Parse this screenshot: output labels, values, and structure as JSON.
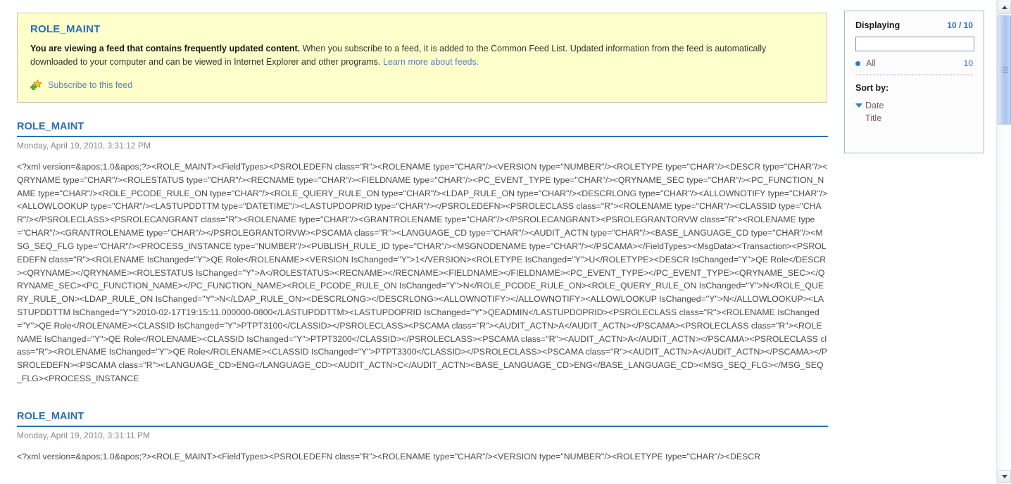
{
  "banner": {
    "title": "ROLE_MAINT",
    "bold_lead": "You are viewing a feed that contains frequently updated content.",
    "body": " When you subscribe to a feed, it is added to the Common Feed List. Updated information from the feed is automatically downloaded to your computer and can be viewed in Internet Explorer and other programs. ",
    "learn_more": "Learn more about feeds.",
    "subscribe_label": "Subscribe to this feed",
    "subscribe_icon": "add-to-favorites-star-icon",
    "background_color": "#FFFFCC",
    "title_color": "#2A6FB5"
  },
  "sidebar": {
    "displaying_label": "Displaying",
    "displaying_count": "10 / 10",
    "search_value": "",
    "search_placeholder": "",
    "filter": {
      "label": "All",
      "count": "10",
      "selected": true
    },
    "sort_by_label": "Sort by:",
    "sort_options": [
      {
        "label": "Date",
        "active": true,
        "icon": "chevron-down-icon"
      },
      {
        "label": "Title",
        "active": false,
        "icon": ""
      }
    ]
  },
  "entries": [
    {
      "title": "ROLE_MAINT",
      "date": "Monday, April 19, 2010, 3:31:12 PM",
      "body": "<?xml version=&apos;1.0&apos;?><ROLE_MAINT><FieldTypes><PSROLEDEFN class=\"R\"><ROLENAME type=\"CHAR\"/><VERSION type=\"NUMBER\"/><ROLETYPE type=\"CHAR\"/><DESCR type=\"CHAR\"/><QRYNAME type=\"CHAR\"/><ROLESTATUS type=\"CHAR\"/><RECNAME type=\"CHAR\"/><FIELDNAME type=\"CHAR\"/><PC_EVENT_TYPE type=\"CHAR\"/><QRYNAME_SEC type=\"CHAR\"/><PC_FUNCTION_NAME type=\"CHAR\"/><ROLE_PCODE_RULE_ON type=\"CHAR\"/><ROLE_QUERY_RULE_ON type=\"CHAR\"/><LDAP_RULE_ON type=\"CHAR\"/><DESCRLONG type=\"CHAR\"/><ALLOWNOTIFY type=\"CHAR\"/><ALLOWLOOKUP type=\"CHAR\"/><LASTUPDDTTM type=\"DATETIME\"/><LASTUPDOPRID type=\"CHAR\"/></PSROLEDEFN><PSROLECLASS class=\"R\"><ROLENAME type=\"CHAR\"/><CLASSID type=\"CHAR\"/></PSROLECLASS><PSROLECANGRANT class=\"R\"><ROLENAME type=\"CHAR\"/><GRANTROLENAME type=\"CHAR\"/></PSROLECANGRANT><PSROLEGRANTORVW class=\"R\"><ROLENAME type=\"CHAR\"/><GRANTROLENAME type=\"CHAR\"/></PSROLEGRANTORVW><PSCAMA class=\"R\"><LANGUAGE_CD type=\"CHAR\"/><AUDIT_ACTN type=\"CHAR\"/><BASE_LANGUAGE_CD type=\"CHAR\"/><MSG_SEQ_FLG type=\"CHAR\"/><PROCESS_INSTANCE type=\"NUMBER\"/><PUBLISH_RULE_ID type=\"CHAR\"/><MSGNODENAME type=\"CHAR\"/></PSCAMA></FieldTypes><MsgData><Transaction><PSROLEDEFN class=\"R\"><ROLENAME IsChanged=\"Y\">QE Role</ROLENAME><VERSION IsChanged=\"Y\">1</VERSION><ROLETYPE IsChanged=\"Y\">U</ROLETYPE><DESCR IsChanged=\"Y\">QE Role</DESCR><QRYNAME></QRYNAME><ROLESTATUS IsChanged=\"Y\">A</ROLESTATUS><RECNAME></RECNAME><FIELDNAME></FIELDNAME><PC_EVENT_TYPE></PC_EVENT_TYPE><QRYNAME_SEC></QRYNAME_SEC><PC_FUNCTION_NAME></PC_FUNCTION_NAME><ROLE_PCODE_RULE_ON IsChanged=\"Y\">N</ROLE_PCODE_RULE_ON><ROLE_QUERY_RULE_ON IsChanged=\"Y\">N</ROLE_QUERY_RULE_ON><LDAP_RULE_ON IsChanged=\"Y\">N</LDAP_RULE_ON><DESCRLONG></DESCRLONG><ALLOWNOTIFY></ALLOWNOTIFY><ALLOWLOOKUP IsChanged=\"Y\">N</ALLOWLOOKUP><LASTUPDDTTM IsChanged=\"Y\">2010-02-17T19:15:11.000000-0800</LASTUPDDTTM><LASTUPDOPRID IsChanged=\"Y\">QEADMIN</LASTUPDOPRID><PSROLECLASS class=\"R\"><ROLENAME IsChanged=\"Y\">QE Role</ROLENAME><CLASSID IsChanged=\"Y\">PTPT3100</CLASSID></PSROLECLASS><PSCAMA class=\"R\"><AUDIT_ACTN>A</AUDIT_ACTN></PSCAMA><PSROLECLASS class=\"R\"><ROLENAME IsChanged=\"Y\">QE Role</ROLENAME><CLASSID IsChanged=\"Y\">PTPT3200</CLASSID></PSROLECLASS><PSCAMA class=\"R\"><AUDIT_ACTN>A</AUDIT_ACTN></PSCAMA><PSROLECLASS class=\"R\"><ROLENAME IsChanged=\"Y\">QE Role</ROLENAME><CLASSID IsChanged=\"Y\">PTPT3300</CLASSID></PSROLECLASS><PSCAMA class=\"R\"><AUDIT_ACTN>A</AUDIT_ACTN></PSCAMA></PSROLEDEFN><PSCAMA class=\"R\"><LANGUAGE_CD>ENG</LANGUAGE_CD><AUDIT_ACTN>C</AUDIT_ACTN><BASE_LANGUAGE_CD>ENG</BASE_LANGUAGE_CD><MSG_SEQ_FLG></MSG_SEQ_FLG><PROCESS_INSTANCE"
    },
    {
      "title": "ROLE_MAINT",
      "date": "Monday, April 19, 2010, 3:31:11 PM",
      "body": "<?xml version=&apos;1.0&apos;?><ROLE_MAINT><FieldTypes><PSROLEDEFN class=\"R\"><ROLENAME type=\"CHAR\"/><VERSION type=\"NUMBER\"/><ROLETYPE type=\"CHAR\"/><DESCR"
    }
  ],
  "scrollbar": {
    "up_icon": "chevron-up-icon",
    "down_icon": "chevron-down-icon"
  }
}
